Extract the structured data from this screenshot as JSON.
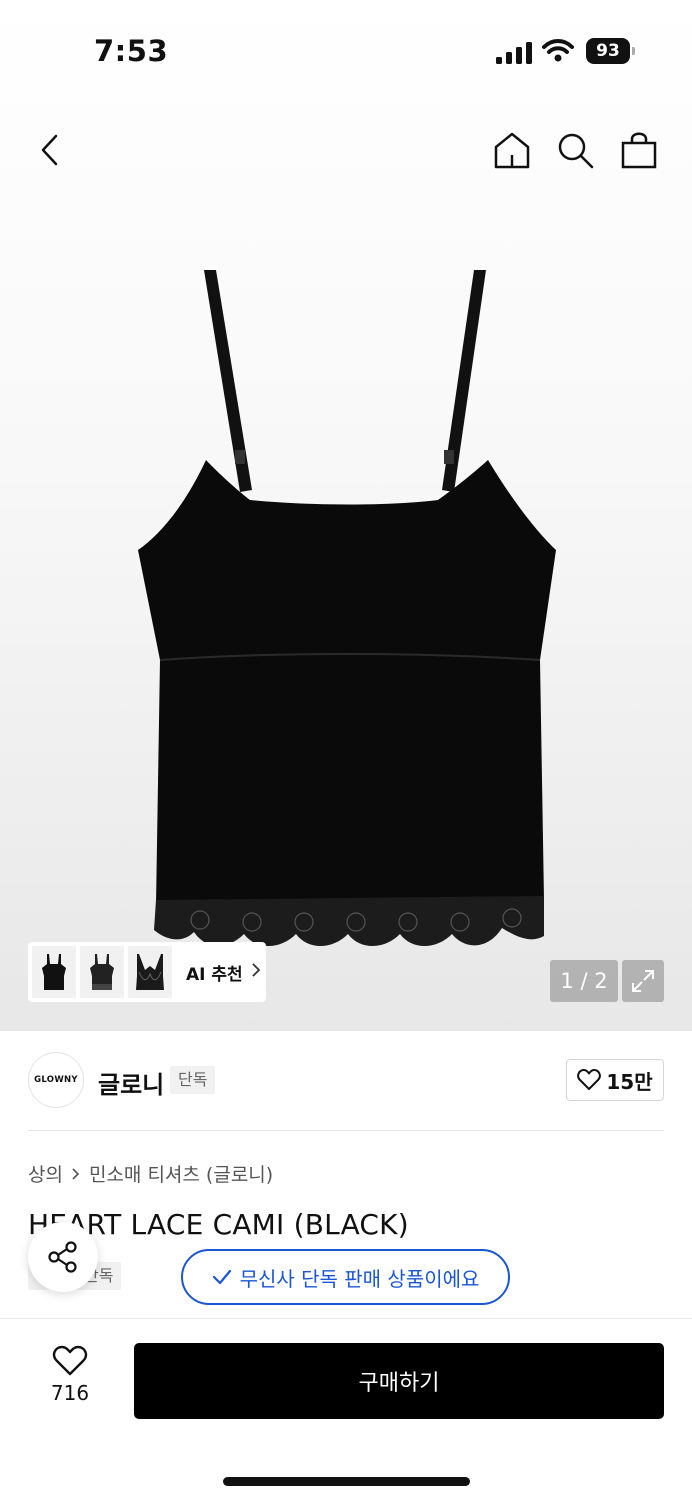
{
  "status_bar": {
    "time": "7:53",
    "battery": "93"
  },
  "nav": {
    "icons": [
      "back-icon",
      "home-icon",
      "search-icon",
      "shopping-bag-icon"
    ]
  },
  "gallery": {
    "ai_recommend_label": "AI 추천",
    "page_indicator": "1 / 2",
    "thumbnails": [
      "black-cami-thumb",
      "lace-cami-thumb",
      "lace-bra-top-thumb"
    ]
  },
  "brand": {
    "logo_text": "GLOWNY",
    "name": "글로니",
    "badge": "단독",
    "likes": "15만"
  },
  "breadcrumb": {
    "category": "상의",
    "subcategory": "민소매 티셔츠 (글로니)"
  },
  "product": {
    "title": "HEART LACE CAMI (BLACK)",
    "exclusive_tag": "단독",
    "exclusive_notice": "무신사 단독 판매 상품이에요"
  },
  "bottom_bar": {
    "like_count": "716",
    "buy_label": "구매하기"
  },
  "colors": {
    "accent_blue": "#1a56d6",
    "buy_button": "#000000"
  }
}
